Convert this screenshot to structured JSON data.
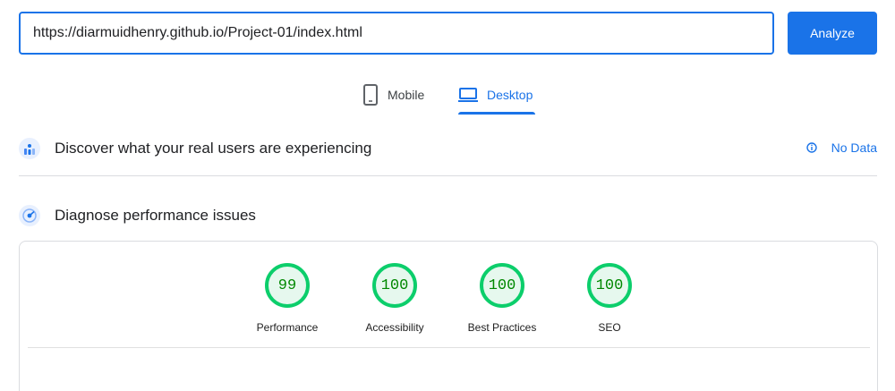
{
  "search": {
    "url_value": "https://diarmuidhenry.github.io/Project-01/index.html",
    "analyze_label": "Analyze"
  },
  "tabs": [
    {
      "label": "Mobile",
      "icon": "smartphone-icon",
      "active": false
    },
    {
      "label": "Desktop",
      "icon": "laptop-icon",
      "active": true
    }
  ],
  "discover": {
    "title": "Discover what your real users are experiencing",
    "icon": "users-chart-icon",
    "status_label": "No Data",
    "status_icon": "info-icon"
  },
  "diagnose": {
    "title": "Diagnose performance issues",
    "icon": "gauge-icon"
  },
  "scores": [
    {
      "value": "99",
      "label": "Performance"
    },
    {
      "value": "100",
      "label": "Accessibility"
    },
    {
      "value": "100",
      "label": "Best Practices"
    },
    {
      "value": "100",
      "label": "SEO"
    }
  ],
  "colors": {
    "accent": "#1a73e8",
    "pass": "#0cce6b",
    "pass_text": "#008800"
  }
}
